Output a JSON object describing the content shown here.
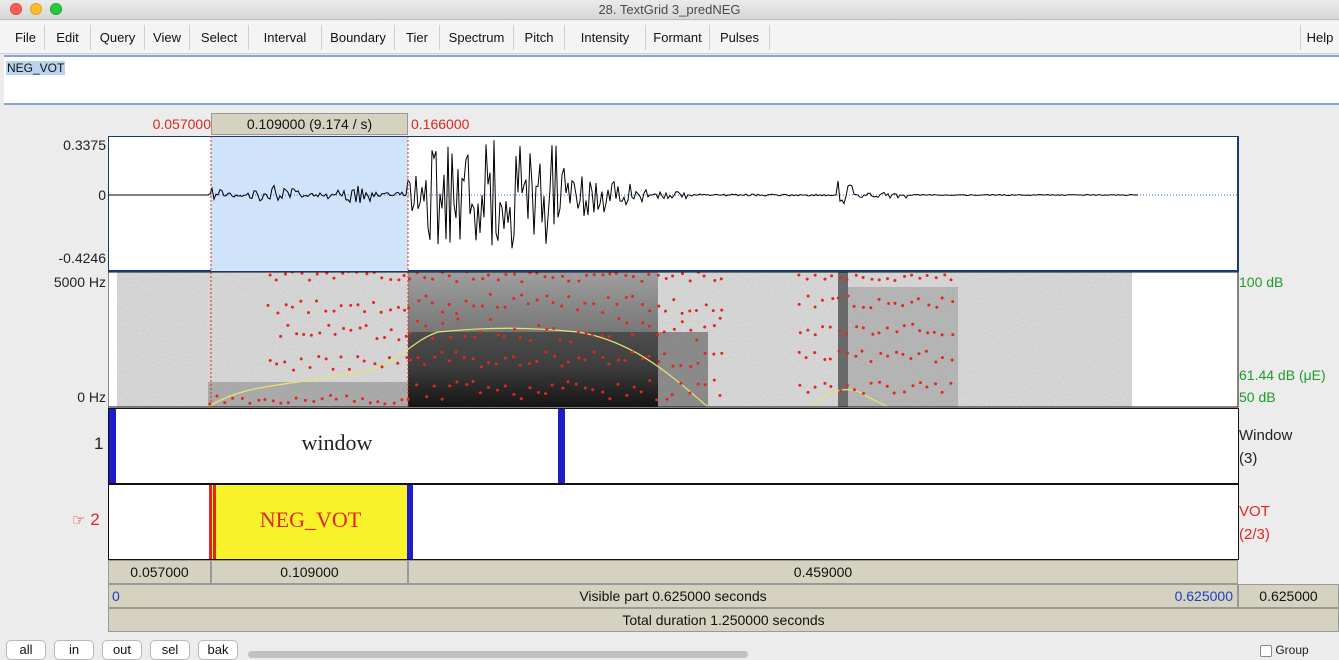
{
  "window": {
    "title": "28. TextGrid 3_predNEG"
  },
  "menu": [
    "File",
    "Edit",
    "Query",
    "View",
    "Select",
    "Interval",
    "Boundary",
    "Tier",
    "Spectrum",
    "Pitch",
    "Intensity",
    "Formant",
    "Pulses"
  ],
  "menu_help": "Help",
  "text_field": {
    "value": "NEG_VOT"
  },
  "selection_bar": {
    "start": "0.057000",
    "duration": "0.109000 (9.174 / s)",
    "end": "0.166000"
  },
  "waveform": {
    "max": "0.3375",
    "zero": "0",
    "min": "-0.4246"
  },
  "spectrogram": {
    "top_freq": "5000 Hz",
    "bottom_freq": "0 Hz",
    "db_top": "100 dB",
    "db_current": "61.44 dB (μE)",
    "db_bottom": "50 dB"
  },
  "tiers": [
    {
      "number": "1",
      "interval_text": "window",
      "name": "Window",
      "count": "(3)"
    },
    {
      "number": "2",
      "pointer": "☞",
      "interval_text": "NEG_VOT",
      "name": "VOT",
      "count": "(2/3)"
    }
  ],
  "durations": {
    "left": "0.057000",
    "middle": "0.109000",
    "right": "0.459000"
  },
  "visible": {
    "start": "0",
    "label": "Visible part 0.625000 seconds",
    "end": "0.625000",
    "right_total": "0.625000"
  },
  "total": {
    "label": "Total duration 1.250000 seconds"
  },
  "buttons": [
    "all",
    "in",
    "out",
    "sel",
    "bak"
  ],
  "group_label": "Group",
  "colors": {
    "selection": "#cfe3fb",
    "interval_highlight": "#f7f22a",
    "boundary": "#1c1cc9",
    "cursor": "#e3271c",
    "db_green": "#1f9b2a"
  }
}
